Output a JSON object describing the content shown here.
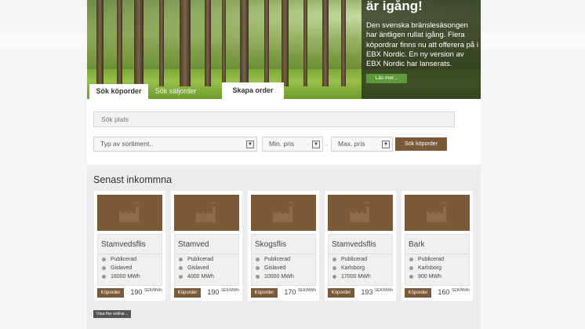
{
  "hero": {
    "title": "är igång!",
    "text": "Den svenska bränslesäsongen har äntligen rullat igång. Flera köpordrar finns nu att offerera på i EBX Nordic. En ny version av EBX Nordic har lanserats.",
    "read_more": "Läs mer..."
  },
  "tabs": [
    {
      "label": "Sök köporder"
    },
    {
      "label": "Sök säljorder"
    },
    {
      "label": "Skapa order"
    }
  ],
  "search": {
    "place_placeholder": "Sök plats",
    "assortment": "Typ av sortiment..",
    "min_price": "Min. pris",
    "max_price": "Max. pris",
    "separator": "-",
    "button": "Sök köporder"
  },
  "recent": {
    "title": "Senast inkommna",
    "more_button": "Visa fler ordrar...",
    "cards": [
      {
        "name": "Stamvedsflis",
        "status": "Publicerad",
        "location": "Gislaved",
        "volume": "16000 MWh",
        "button": "Köporder",
        "price": "190",
        "unit": "SEK/MWh"
      },
      {
        "name": "Stamved",
        "status": "Publicerad",
        "location": "Gislaved",
        "volume": "4000 MWh",
        "button": "Köporder",
        "price": "190",
        "unit": "SEK/MWh"
      },
      {
        "name": "Skogsflis",
        "status": "Publicerad",
        "location": "Gislaved",
        "volume": "10000 MWh",
        "button": "Köporder",
        "price": "170",
        "unit": "SEK/MWh"
      },
      {
        "name": "Stamvedsflis",
        "status": "Publicerad",
        "location": "Karlsborg",
        "volume": "17000 MWh",
        "button": "Köporder",
        "price": "193",
        "unit": "SEK/MWh"
      },
      {
        "name": "Bark",
        "status": "Publicerad",
        "location": "Karlsborg",
        "volume": "900 MWh",
        "button": "Köporder",
        "price": "160",
        "unit": "SEK/MWh"
      }
    ]
  },
  "colors": {
    "brand_brown": "#7a5a38",
    "read_more_green": "#5d9a3a"
  },
  "icons": [
    "factory-icon",
    "status-icon",
    "location-icon",
    "volume-icon",
    "dropdown-arrow-icon"
  ]
}
